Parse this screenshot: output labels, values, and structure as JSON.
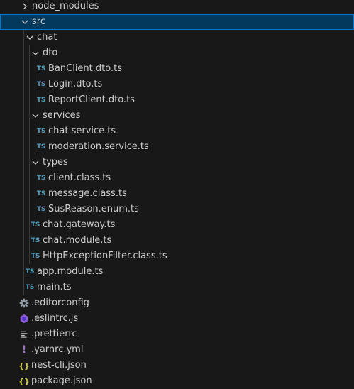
{
  "explorer": {
    "items": [
      {
        "label": "node_modules",
        "kind": "folder",
        "expanded": false,
        "icon": "chevron-right-icon"
      },
      {
        "label": "src",
        "kind": "folder",
        "expanded": true,
        "selected": true,
        "icon": "chevron-down-icon"
      },
      {
        "label": "chat",
        "kind": "folder",
        "expanded": true,
        "icon": "chevron-down-icon"
      },
      {
        "label": "dto",
        "kind": "folder",
        "expanded": true,
        "icon": "chevron-down-icon"
      },
      {
        "label": "BanClient.dto.ts",
        "kind": "file",
        "icon_text": "TS"
      },
      {
        "label": "Login.dto.ts",
        "kind": "file",
        "icon_text": "TS"
      },
      {
        "label": "ReportClient.dto.ts",
        "kind": "file",
        "icon_text": "TS"
      },
      {
        "label": "services",
        "kind": "folder",
        "expanded": true,
        "icon": "chevron-down-icon"
      },
      {
        "label": "chat.service.ts",
        "kind": "file",
        "icon_text": "TS"
      },
      {
        "label": "moderation.service.ts",
        "kind": "file",
        "icon_text": "TS"
      },
      {
        "label": "types",
        "kind": "folder",
        "expanded": true,
        "icon": "chevron-down-icon"
      },
      {
        "label": "client.class.ts",
        "kind": "file",
        "icon_text": "TS"
      },
      {
        "label": "message.class.ts",
        "kind": "file",
        "icon_text": "TS"
      },
      {
        "label": "SusReason.enum.ts",
        "kind": "file",
        "icon_text": "TS"
      },
      {
        "label": "chat.gateway.ts",
        "kind": "file",
        "icon_text": "TS"
      },
      {
        "label": "chat.module.ts",
        "kind": "file",
        "icon_text": "TS"
      },
      {
        "label": "HttpExceptionFilter.class.ts",
        "kind": "file",
        "icon_text": "TS"
      },
      {
        "label": "app.module.ts",
        "kind": "file",
        "icon_text": "TS"
      },
      {
        "label": "main.ts",
        "kind": "file",
        "icon_text": "TS"
      },
      {
        "label": ".editorconfig",
        "kind": "file",
        "icon": "gear-icon"
      },
      {
        "label": ".eslintrc.js",
        "kind": "file",
        "icon": "eslint-icon"
      },
      {
        "label": ".prettierrc",
        "kind": "file",
        "icon": "prettier-icon"
      },
      {
        "label": ".yarnrc.yml",
        "kind": "file",
        "icon_text": "!"
      },
      {
        "label": "nest-cli.json",
        "kind": "file",
        "icon_text": "{}"
      },
      {
        "label": "package.json",
        "kind": "file",
        "icon_text": "{}"
      }
    ]
  },
  "colors": {
    "background": "#181818",
    "selection_bg": "#04395e",
    "selection_border": "#0078d4",
    "ts_icon": "#519aba",
    "json_icon": "#cbcb41",
    "yml_icon": "#a074c4",
    "eslint_icon": "#8c5cd6",
    "gear_icon": "#8f9ba5"
  }
}
